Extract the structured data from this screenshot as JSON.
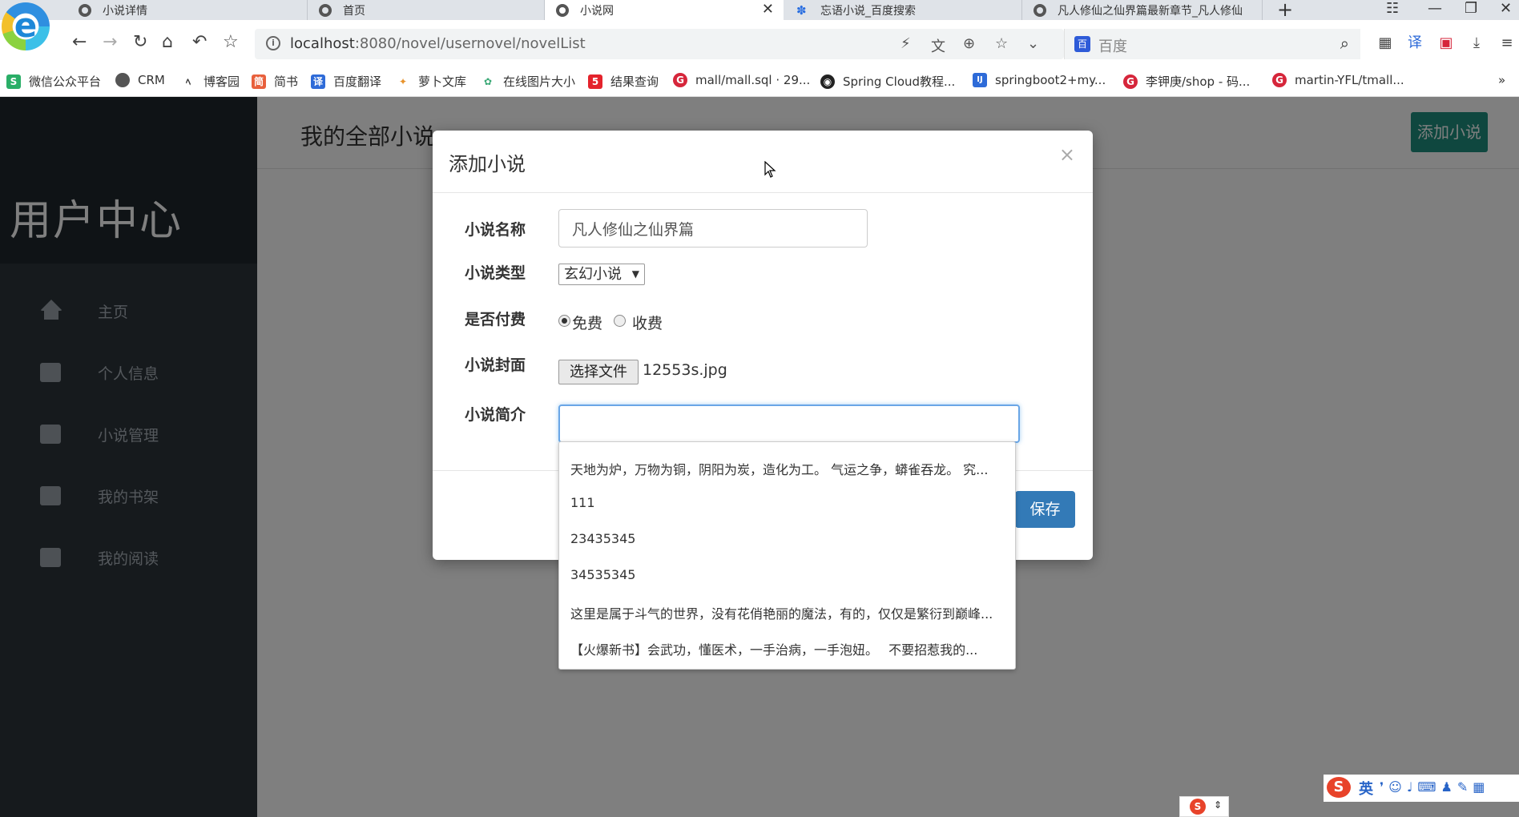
{
  "browser": {
    "logo_letter": "e",
    "tabs": [
      {
        "title": "小说详情"
      },
      {
        "title": "首页"
      },
      {
        "title": "小说网"
      },
      {
        "title": "忘语小说_百度搜索"
      },
      {
        "title": "凡人修仙之仙界篇最新章节_凡人修仙"
      }
    ],
    "active_tab_index": 2,
    "new_tab": "+",
    "url_host": "localhost",
    "url_rest": ":8080/novel/usernovel/novelList",
    "search_placeholder": "百度",
    "search_engine_badge": "百"
  },
  "bookmarks": [
    {
      "label": "微信公众平台",
      "color": "#2aae67",
      "glyph": "S"
    },
    {
      "label": "CRM",
      "color": "#555555",
      "glyph": "●"
    },
    {
      "label": "博客园",
      "color": "#555555",
      "glyph": "ﾍ"
    },
    {
      "label": "简书",
      "color": "#e8603c",
      "glyph": "简"
    },
    {
      "label": "百度翻译",
      "color": "#2e6bd8",
      "glyph": "译"
    },
    {
      "label": "萝卜文库",
      "color": "#e7922b",
      "glyph": "✦"
    },
    {
      "label": "在线图片大小",
      "color": "#3aa876",
      "glyph": "✿"
    },
    {
      "label": "结果查询",
      "color": "#e4232c",
      "glyph": "5"
    },
    {
      "label": "mall/mall.sql · 29...",
      "color": "#d6263b",
      "glyph": "G"
    },
    {
      "label": "Spring Cloud教程...",
      "color": "#222222",
      "glyph": "◉"
    },
    {
      "label": "springboot2+my...",
      "color": "#2e6bd8",
      "glyph": "IJ"
    },
    {
      "label": "李钾庚/shop - 码...",
      "color": "#d6263b",
      "glyph": "G"
    },
    {
      "label": "martin-YFL/tmall...",
      "color": "#d6263b",
      "glyph": "G"
    }
  ],
  "bookmarks_more": "»",
  "sidebar": {
    "title": "用户中心",
    "items": [
      {
        "label": "主页",
        "icon": "home-icon"
      },
      {
        "label": "个人信息",
        "icon": "inbox-icon"
      },
      {
        "label": "小说管理",
        "icon": "inbox-icon"
      },
      {
        "label": "我的书架",
        "icon": "inbox-icon"
      },
      {
        "label": "我的阅读",
        "icon": "inbox-icon"
      }
    ]
  },
  "content": {
    "title": "我的全部小说",
    "add_button": "添加小说"
  },
  "modal": {
    "title": "添加小说",
    "close": "×",
    "fields": {
      "name_label": "小说名称",
      "name_value": "凡人修仙之仙界篇",
      "type_label": "小说类型",
      "type_value": "玄幻小说",
      "pay_label": "是否付费",
      "pay_free": "免费",
      "pay_paid": "收费",
      "pay_selected": "免费",
      "cover_label": "小说封面",
      "cover_button": "选择文件",
      "cover_file": "12553s.jpg",
      "intro_label": "小说简介",
      "intro_value": ""
    },
    "save_button": "保存"
  },
  "autocomplete": [
    "天地为炉，万物为铜，阴阳为炭，造化为工。 气运之争，蟒雀吞龙。 究...",
    "111",
    "23435345",
    "34535345",
    "这里是属于斗气的世界，没有花俏艳丽的魔法，有的，仅仅是繁衍到巅峰...",
    "【火爆新书】会武功，懂医术，一手治病，一手泡妞。　 不要招惹我的..."
  ],
  "ime": {
    "logo": "S",
    "mode": "英"
  }
}
